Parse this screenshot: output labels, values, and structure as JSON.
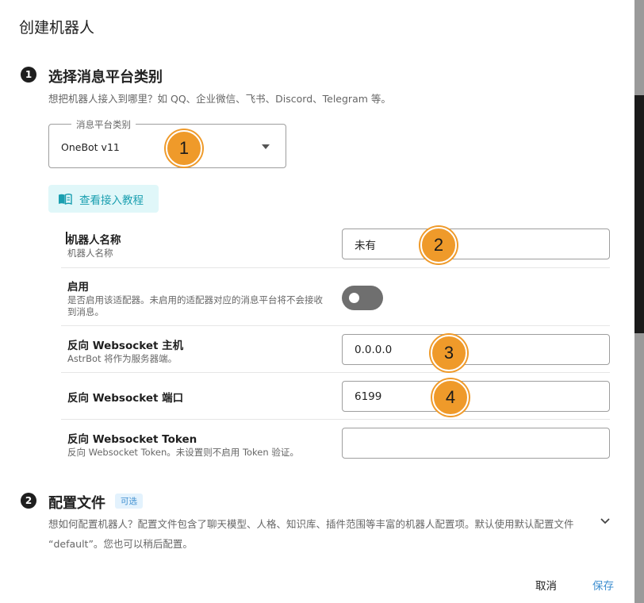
{
  "dialog": {
    "title": "创建机器人"
  },
  "step1": {
    "number": "1",
    "title": "选择消息平台类别",
    "subtitle": "想把机器人接入到哪里？如 QQ、企业微信、飞书、Discord、Telegram 等。",
    "platform_select": {
      "label": "消息平台类别",
      "value": "OneBot v11"
    },
    "tutorial_button": "查看接入教程"
  },
  "fields": {
    "bot_name": {
      "label": "机器人名称",
      "desc": "机器人名称",
      "value": "未有"
    },
    "enable": {
      "label": "启用",
      "desc": "是否启用该适配器。未启用的适配器对应的消息平台将不会接收到消息。",
      "enabled": false
    },
    "ws_host": {
      "label": "反向 Websocket 主机",
      "desc": "AstrBot 将作为服务器端。",
      "value": "0.0.0.0"
    },
    "ws_port": {
      "label": "反向 Websocket 端口",
      "value": "6199"
    },
    "ws_token": {
      "label": "反向 Websocket Token",
      "desc": "反向 Websocket Token。未设置则不启用 Token 验证。",
      "value": ""
    }
  },
  "step2": {
    "number": "2",
    "title": "配置文件",
    "optional_chip": "可选",
    "description": "想如何配置机器人？配置文件包含了聊天模型、人格、知识库、插件范围等丰富的机器人配置项。默认使用默认配置文件 “default”。您也可以稍后配置。"
  },
  "annotations": [
    "1",
    "2",
    "3",
    "4"
  ],
  "footer": {
    "cancel": "取消",
    "save": "保存"
  },
  "colors": {
    "accent": "#3f8fd0",
    "teal": "#1a9fb0",
    "annotation": "#ef9a2a"
  }
}
